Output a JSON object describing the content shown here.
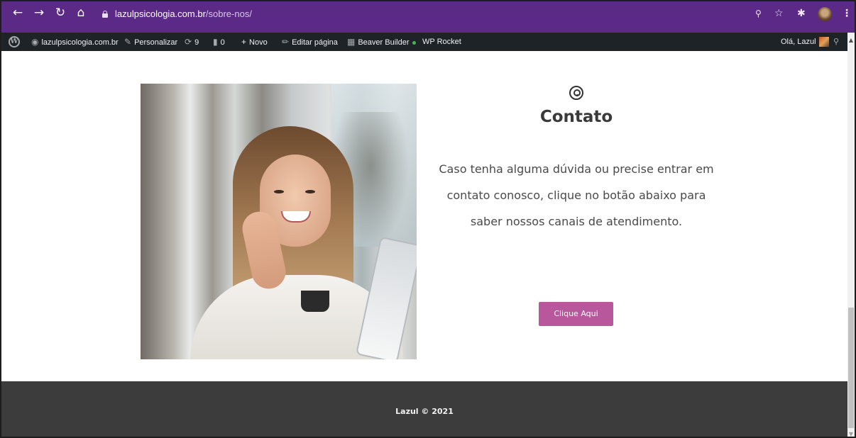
{
  "browser": {
    "url_host": "lazulpsicologia.com.br",
    "url_path": "/sobre-nos/",
    "icons": [
      "back-icon",
      "forward-icon",
      "reload-icon",
      "home-icon",
      "lock-icon",
      "zoom-icon",
      "star-icon",
      "extensions-icon",
      "profile-avatar",
      "menu-icon"
    ]
  },
  "admin_bar": {
    "site_name": "lazulpsicologia.com.br",
    "customize": "Personalizar",
    "updates_count": "9",
    "comments_count": "0",
    "new": "Novo",
    "edit_page": "Editar página",
    "beaver_builder": "Beaver Builder",
    "wp_rocket": "WP Rocket",
    "greeting": "Olá, Lazul"
  },
  "contact": {
    "title": "Contato",
    "text": "Caso tenha alguma dúvida ou precise entrar em contato conosco, clique no botão abaixo para saber nossos canais de atendimento.",
    "button_label": "Clique Aqui",
    "button_color": "#b8579b"
  },
  "footer": {
    "text": "Lazul © 2021",
    "background": "#3c3c3c"
  },
  "colors": {
    "chrome": "#5b2a86",
    "admin_bar": "#1d2327"
  }
}
